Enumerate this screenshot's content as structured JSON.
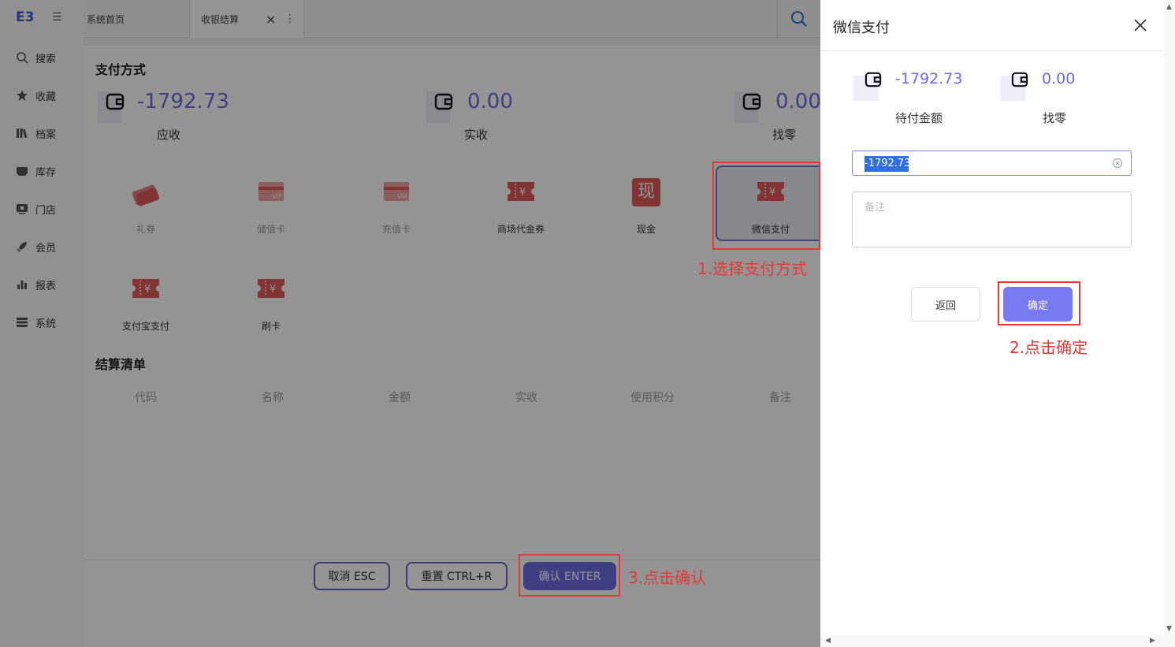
{
  "sidebar": {
    "logo": "E3",
    "items": [
      {
        "label": "搜索",
        "icon": "search-icon"
      },
      {
        "label": "收藏",
        "icon": "star-icon"
      },
      {
        "label": "档案",
        "icon": "archive-icon"
      },
      {
        "label": "库存",
        "icon": "inventory-icon"
      },
      {
        "label": "门店",
        "icon": "store-icon"
      },
      {
        "label": "会员",
        "icon": "rocket-icon"
      },
      {
        "label": "报表",
        "icon": "bar-chart-icon"
      },
      {
        "label": "系统",
        "icon": "server-icon"
      }
    ]
  },
  "tabs": {
    "home": "系统首页",
    "current": "收银结算",
    "close": "×",
    "more": "⋮"
  },
  "payment": {
    "title": "支付方式",
    "receivable": {
      "value": "-1792.73",
      "label": "应收"
    },
    "received": {
      "value": "0.00",
      "label": "实收"
    },
    "change": {
      "value": "0.00",
      "label": "找零"
    },
    "methods": [
      {
        "label": "礼券",
        "icon": "gift-voucher-icon"
      },
      {
        "label": "储值卡",
        "icon": "vip-card-icon"
      },
      {
        "label": "充值卡",
        "icon": "vip-card-icon"
      },
      {
        "label": "商场代金券",
        "icon": "coupon-icon"
      },
      {
        "label": "现金",
        "icon": "cash-icon",
        "glyph": "现"
      },
      {
        "label": "微信支付",
        "icon": "coupon-icon"
      },
      {
        "label": "支付宝支付",
        "icon": "coupon-icon"
      },
      {
        "label": "刷卡",
        "icon": "coupon-icon"
      }
    ]
  },
  "settlement": {
    "title": "结算清单",
    "columns": [
      "代码",
      "名称",
      "金额",
      "实收",
      "使用积分",
      "备注"
    ]
  },
  "footer": {
    "cancel": "取消 ESC",
    "reset": "重置 CTRL+R",
    "confirm": "确认 ENTER"
  },
  "annotations": {
    "step1": "1.选择支付方式",
    "step2": "2.点击确定",
    "step3": "3.点击确认"
  },
  "panel": {
    "title": "微信支付",
    "due": {
      "value": "-1792.73",
      "label": "待付金额"
    },
    "change": {
      "value": "0.00",
      "label": "找零"
    },
    "amount_value": "-1792.73",
    "remark_placeholder": "备注",
    "back": "返回",
    "ok": "确定"
  },
  "colors": {
    "accent": "#6c6cdc",
    "annotation": "#e53935",
    "pay_icon": "#e05a5a"
  }
}
